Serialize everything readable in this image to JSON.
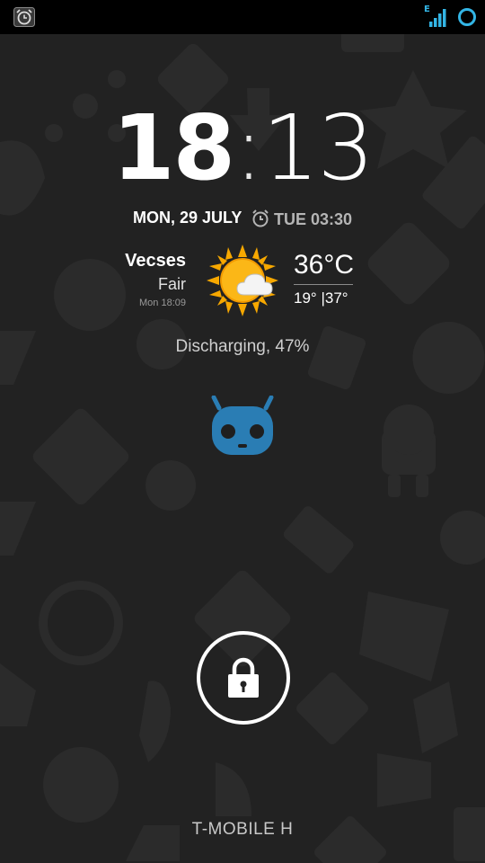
{
  "status_bar": {
    "left_icon": "alarm-clock-icon",
    "network_type": "E",
    "right_icons": [
      "signal-strength-icon",
      "data-sync-ring-icon"
    ]
  },
  "clock": {
    "hours": "18",
    "separator": ":",
    "minutes": "13"
  },
  "date": "MON, 29 JULY",
  "next_alarm": {
    "icon": "alarm-clock-icon",
    "text": "TUE 03:30"
  },
  "weather": {
    "location": "Vecses",
    "condition": "Fair",
    "updated": "Mon 18:09",
    "icon": "sun-cloud-icon",
    "temperature": "36°C",
    "low": "19°",
    "high": "37°",
    "range_separator": "|"
  },
  "battery_status": "Discharging, 47%",
  "branding_icon": "cid-mascot-icon",
  "unlock_icon": "padlock-icon",
  "carrier": "T-MOBILE H",
  "colors": {
    "background": "#222222",
    "status_bar": "#000000",
    "accent": "#33b5e5",
    "mascot": "#2a7db4"
  }
}
